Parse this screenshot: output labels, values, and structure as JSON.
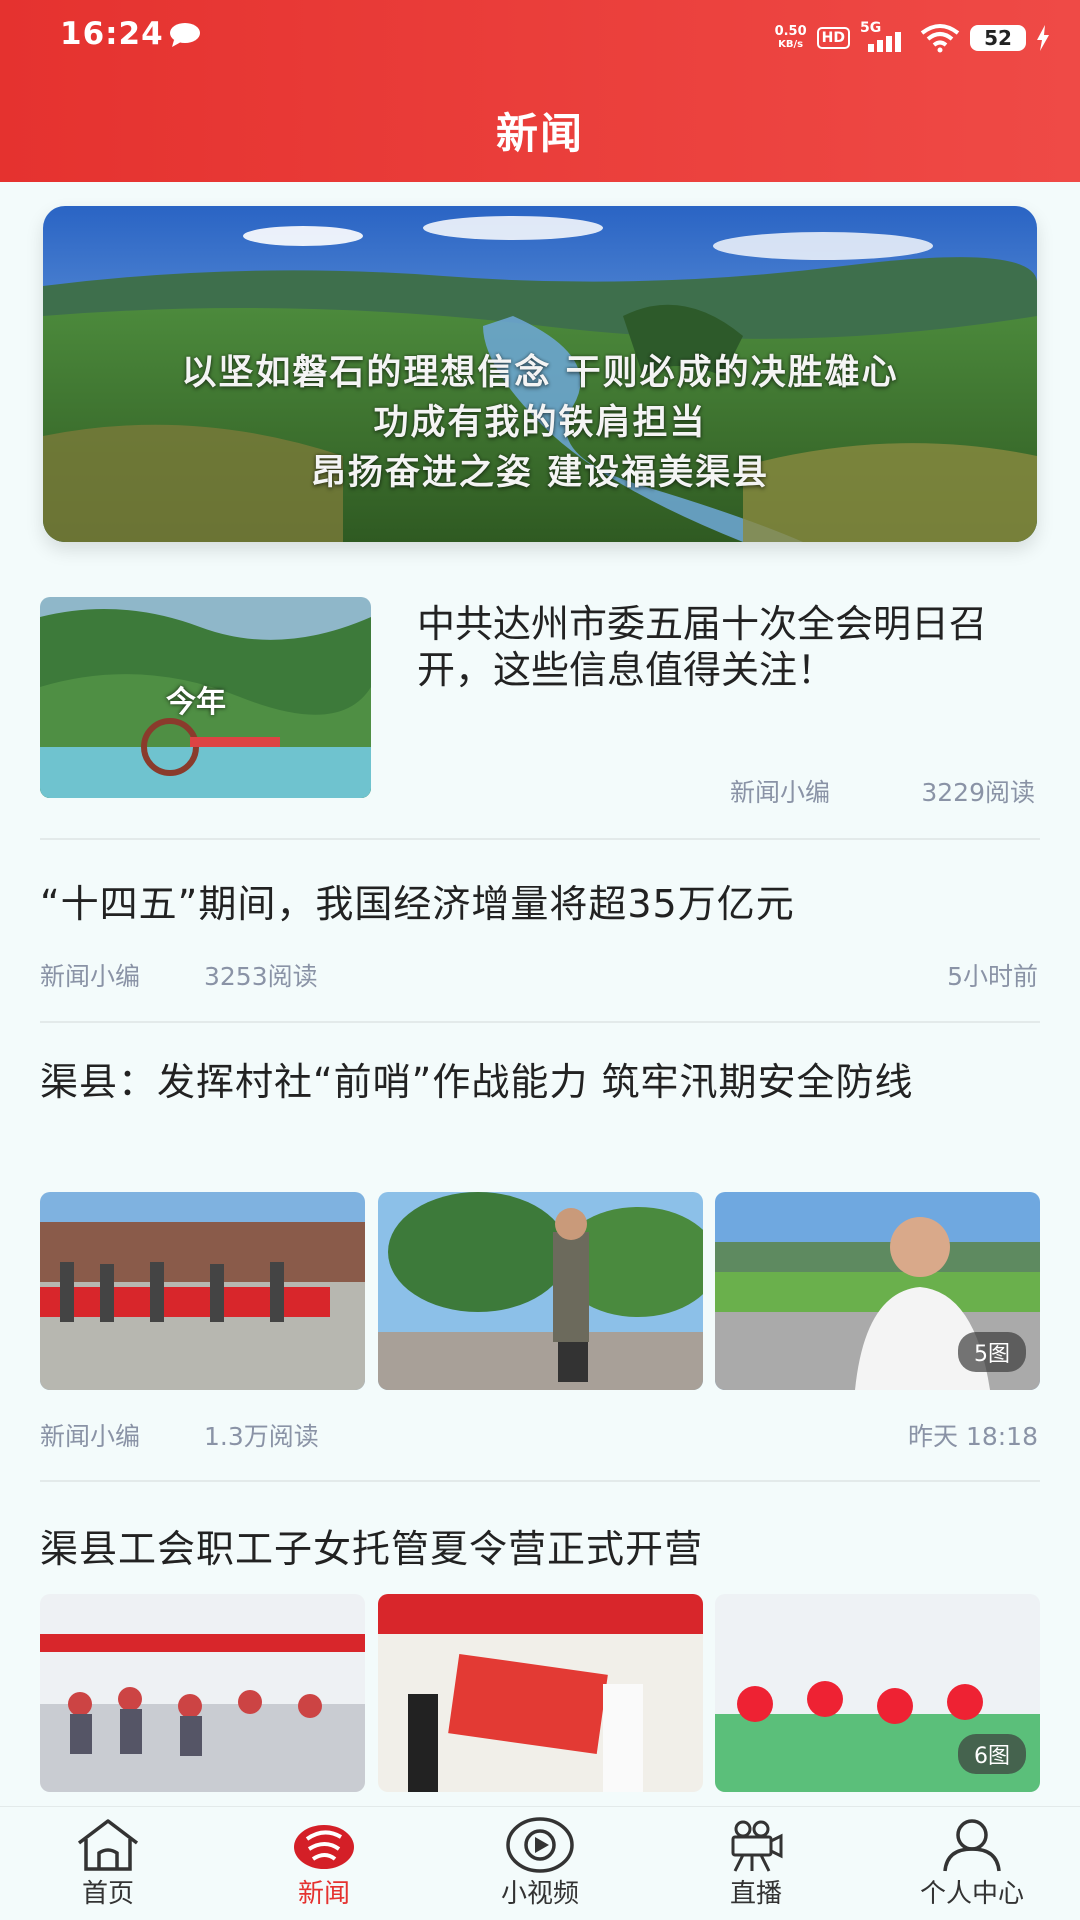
{
  "status_bar": {
    "time": "16:24",
    "net_speed_value": "0.50",
    "net_speed_unit": "KB/s",
    "hd": "HD",
    "network": "5G",
    "battery": "52",
    "icons": [
      "chat-bubble-icon",
      "wifi-icon",
      "charging-bolt-icon"
    ]
  },
  "header": {
    "title": "新闻"
  },
  "banner": {
    "lines": [
      "以坚如磐石的理想信念 干则必成的决胜雄心",
      "功成有我的铁肩担当",
      "昂扬奋进之姿 建设福美渠县"
    ]
  },
  "news": [
    {
      "title": "中共达州市委五届十次全会明日召开，这些信息值得关注！",
      "thumb_caption": "今年",
      "author": "新闻小编",
      "reads": "3229阅读"
    },
    {
      "title": "“十四五”期间，我国经济增量将超35万亿元",
      "author": "新闻小编",
      "reads": "3253阅读",
      "time": "5小时前"
    },
    {
      "title": "渠县：发挥村社“前哨”作战能力 筑牢汛期安全防线",
      "author": "新闻小编",
      "reads": "1.3万阅读",
      "time": "昨天 18:18",
      "image_count": "5图"
    },
    {
      "title": "渠县工会职工子女托管夏令营正式开营",
      "image_count": "6图"
    }
  ],
  "bottom_nav": [
    {
      "label": "首页",
      "icon": "home-icon",
      "active": false
    },
    {
      "label": "新闻",
      "icon": "news-logo-icon",
      "active": true
    },
    {
      "label": "小视频",
      "icon": "play-video-icon",
      "active": false
    },
    {
      "label": "直播",
      "icon": "live-camera-icon",
      "active": false
    },
    {
      "label": "个人中心",
      "icon": "user-icon",
      "active": false
    }
  ],
  "colors": {
    "accent": "#e5322f",
    "background": "#f3fbfb",
    "meta_text": "#8a93a6"
  }
}
